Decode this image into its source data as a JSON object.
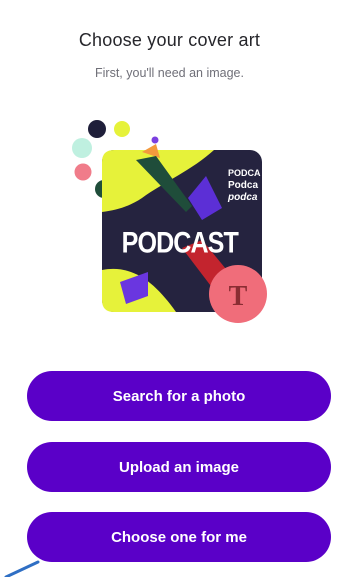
{
  "header": {
    "title": "Choose your cover art",
    "subtitle": "First, you'll need an image."
  },
  "cover_art": {
    "main_text": "PODCAST",
    "side_text": [
      "PODCA",
      "Podca",
      "podca"
    ],
    "badge_letter": "T",
    "colors": {
      "square": "#25233f",
      "blob": "#e6f23a",
      "badge": "#f06d7a",
      "badge_letter": "#8a2d33",
      "purple": "#5c2fd6",
      "orange": "#f39a3d",
      "pink": "#f07c8a",
      "dark_green": "#1f4d3a",
      "navy": "#1f1f3a",
      "lime": "#e6f23a",
      "mint": "#bff0e0"
    }
  },
  "actions": {
    "search_label": "Search for a photo",
    "upload_label": "Upload an image",
    "choose_label": "Choose one for me"
  },
  "accent_color": "#5a00c8"
}
